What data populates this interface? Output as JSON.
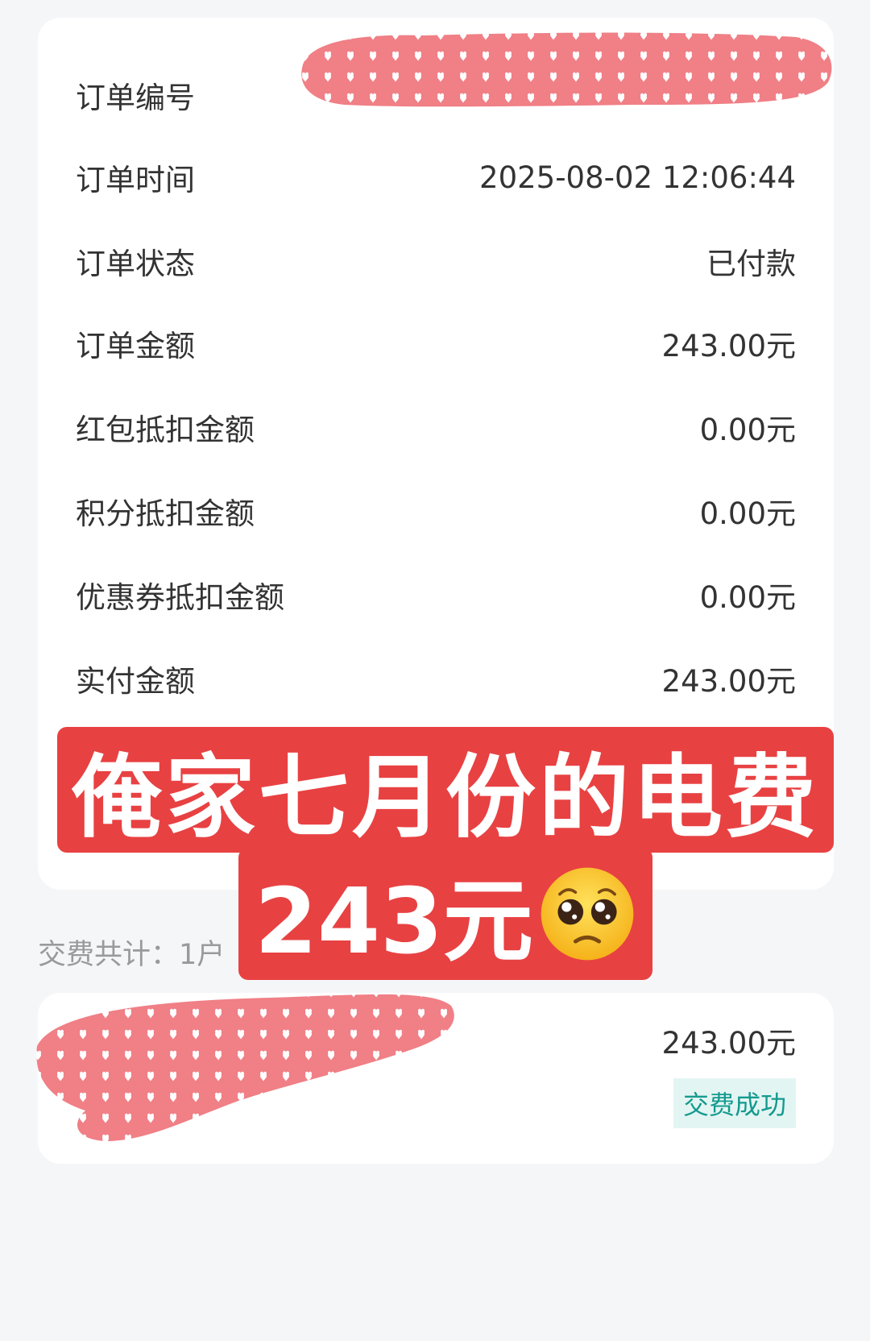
{
  "order": {
    "rows": [
      {
        "label": "订单编号",
        "value": ""
      },
      {
        "label": "订单时间",
        "value": "2025-08-02 12:06:44"
      },
      {
        "label": "订单状态",
        "value": "已付款"
      },
      {
        "label": "订单金额",
        "value": "243.00元"
      },
      {
        "label": "红包抵扣金额",
        "value": "0.00元"
      },
      {
        "label": "积分抵扣金额",
        "value": "0.00元"
      },
      {
        "label": "优惠券抵扣金额",
        "value": "0.00元"
      },
      {
        "label": "实付金额",
        "value": "243.00元"
      }
    ]
  },
  "summary": {
    "text": "交费共计：1户"
  },
  "bill": {
    "amount": "243.00元",
    "status": "交费成功"
  },
  "overlay": {
    "line1": "俺家七月份的电费",
    "line2": "243元",
    "emoji_icon": "pleading-face-icon"
  },
  "colors": {
    "background": "#f5f6f8",
    "card": "#ffffff",
    "overlay_red": "#e84142",
    "status_green": "#159a8f",
    "status_bg": "#e3f5f2",
    "redaction_pink": "#f07f86"
  }
}
